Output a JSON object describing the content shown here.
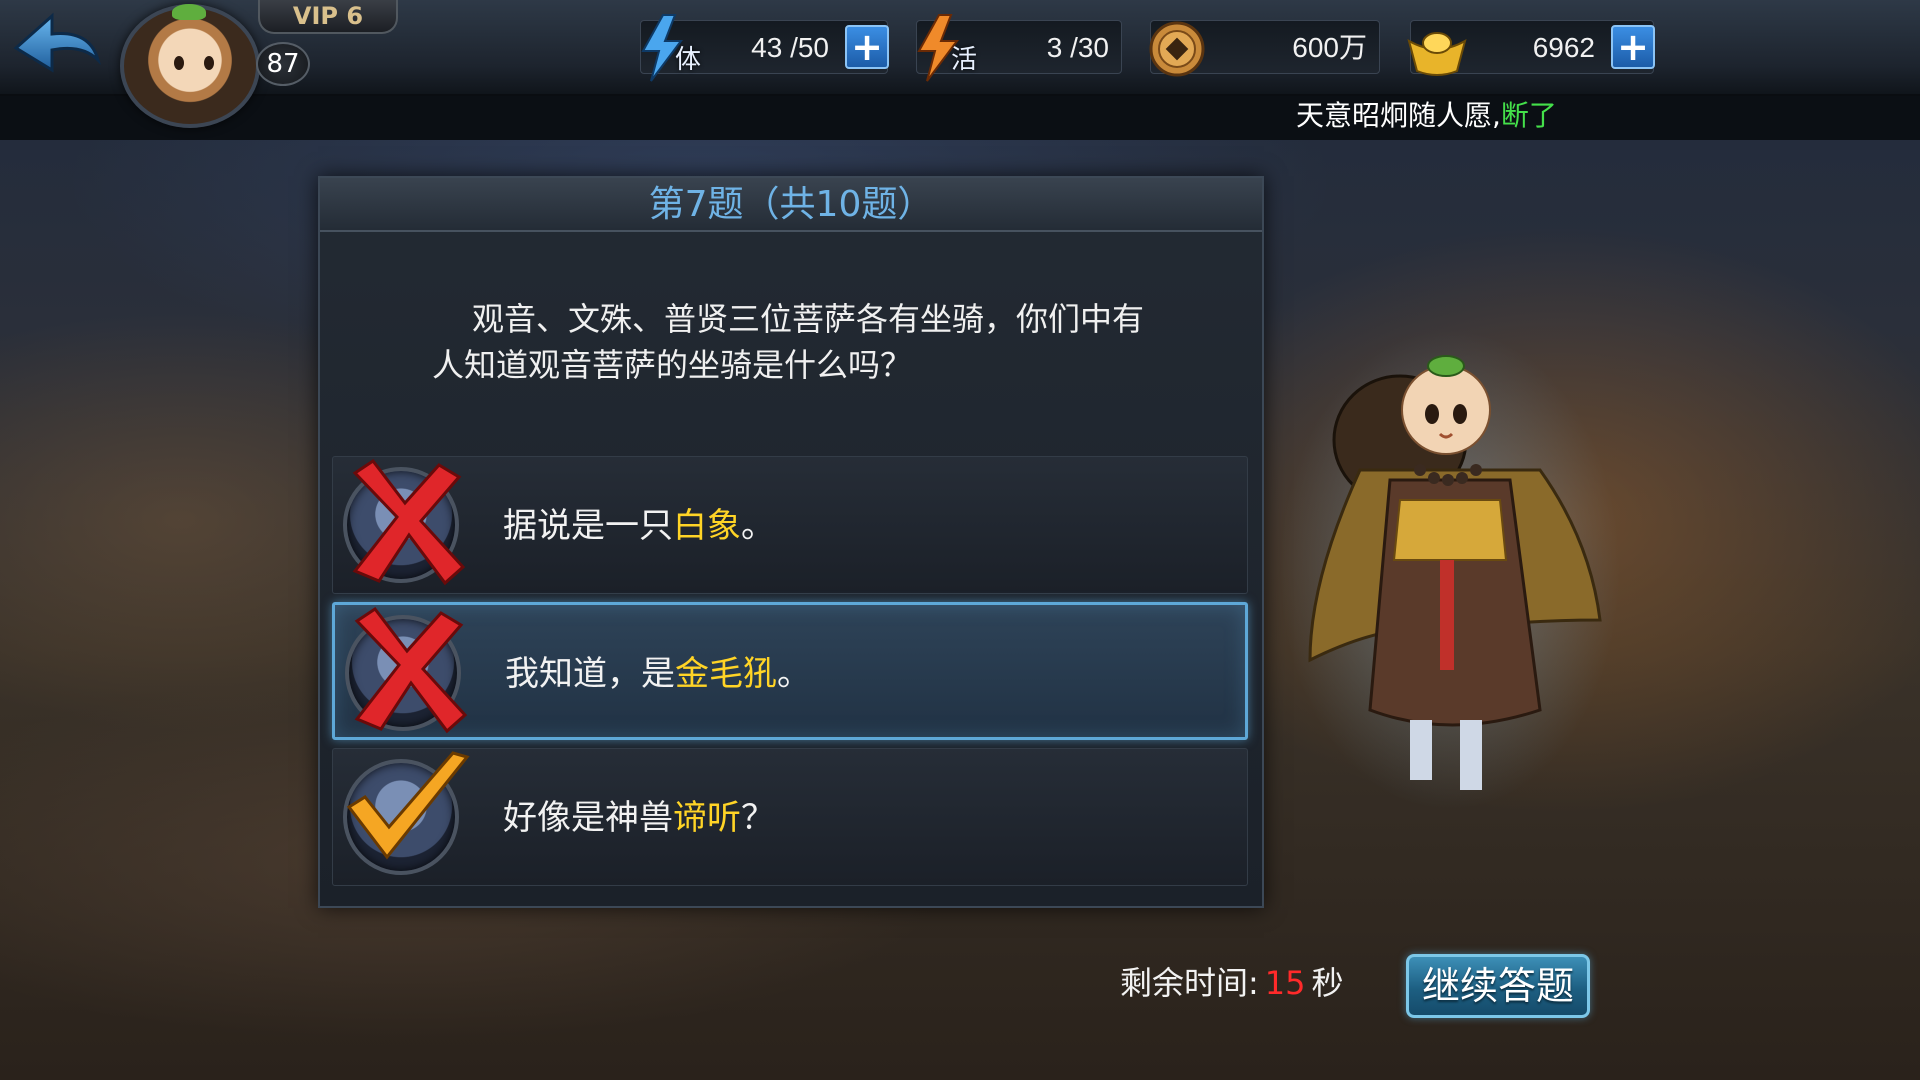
{
  "header": {
    "vip_label": "VIP 6",
    "level": "87",
    "resources": {
      "stamina": {
        "glyph": "体",
        "value": "43 /50",
        "icon": "lightning-bolt-blue"
      },
      "activity": {
        "glyph": "活",
        "value": "3 /30",
        "icon": "lightning-bolt-orange"
      },
      "coins": {
        "value": "600万",
        "icon": "copper-coin"
      },
      "gold": {
        "value": "6962",
        "icon": "gold-ingot"
      }
    },
    "plus_label": "+"
  },
  "marquee": {
    "text": "天意昭炯随人愿,",
    "highlight": "断了",
    "highlight_color": "#44e04a"
  },
  "quiz": {
    "title": "第7题（共10题）",
    "question": "观音、文殊、普贤三位菩萨各有坐骑，你们中有人知道观音菩萨的坐骑是什么吗？",
    "options": [
      {
        "prefix": "据说是一只",
        "highlight": "白象",
        "suffix": "。",
        "result": "wrong",
        "selected": false
      },
      {
        "prefix": "我知道，是",
        "highlight": "金毛犼",
        "suffix": "。",
        "result": "wrong",
        "selected": true
      },
      {
        "prefix": "好像是神兽",
        "highlight": "谛听",
        "suffix": "？",
        "result": "correct",
        "selected": false
      }
    ],
    "highlight_color": "#ffd426"
  },
  "footer": {
    "timer_label": "剩余时间:",
    "timer_value": "15",
    "timer_unit": "秒",
    "continue_label": "继续答题"
  },
  "colors": {
    "accent_blue": "#6fb3e6",
    "timer_red": "#ff2a2a",
    "wrong_red": "#e0262a",
    "correct_gold": "#f5a623"
  }
}
